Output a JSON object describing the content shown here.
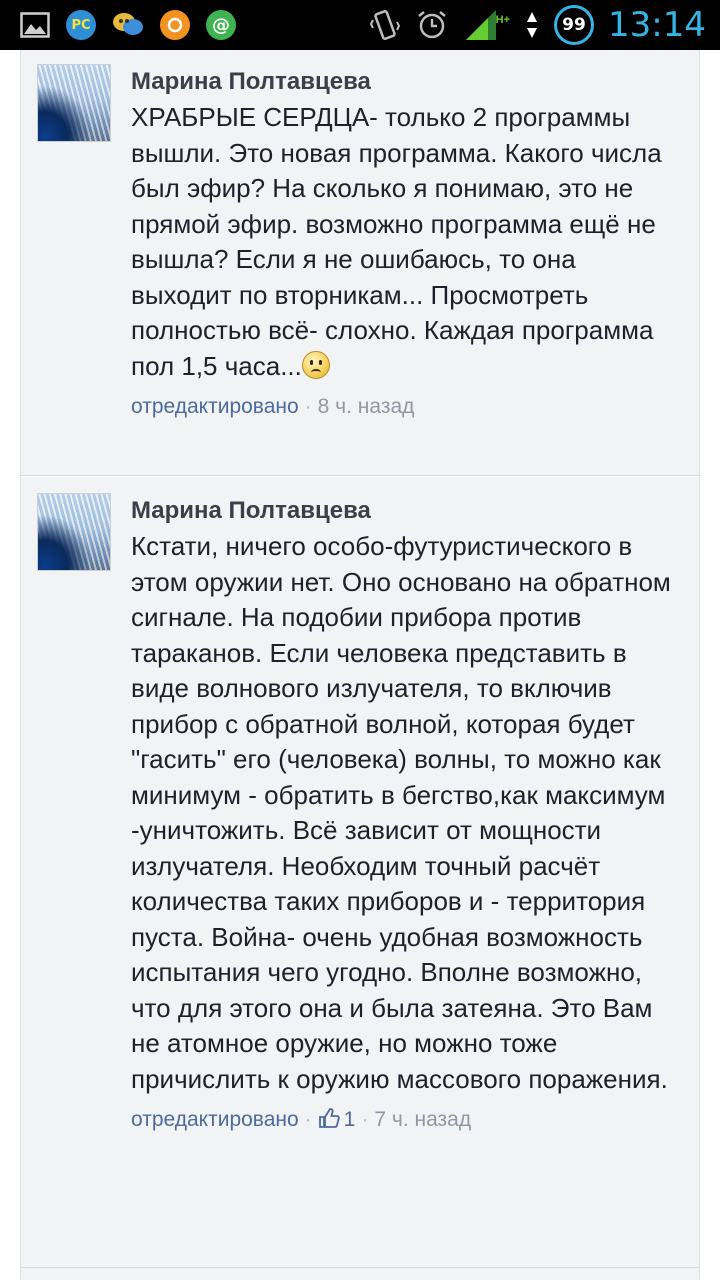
{
  "status_bar": {
    "time": "13:14",
    "battery": "99",
    "network": "H+"
  },
  "colors": {
    "status_accent": "#33b5e5",
    "feed_background": "#f2f3f5",
    "link_blue": "#4b6b9e",
    "meta_gray": "#9197a3"
  },
  "comments": [
    {
      "author": "Марина Полтавцева",
      "text": "ХРАБРЫЕ СЕРДЦА- только 2 программы вышли. Это новая программа. Какого числа был эфир? На сколько я понимаю, это не прямой эфир. возможно программа ещё не вышла? Если я не ошибаюсь, то она выходит по вторникам... Просмотреть полностью всё- слохно. Каждая программа пол 1,5 часа...",
      "emoji": "sad-face-icon",
      "edited": "отредактировано",
      "separator": "·",
      "time": "8 ч. назад"
    },
    {
      "author": "Марина Полтавцева",
      "text": "Кстати, ничего особо-футуристического в этом оружии нет. Оно основано на обратном сигнале. На подобии прибора против тараканов. Если человека представить в виде волнового излучателя, то включив прибор с обратной волной, которая будет \"гасить\" его (человека) волны, то можно как минимум - обратить в бегство,как максимум -уничтожить. Всё зависит от мощности излучателя. Необходим точный расчёт количества таких приборов и - территория пуста. Война- очень удобная возможность испытания чего угодно. Вполне возможно, что для этого она и была затеяна. Это Вам не атомное оружие, но можно тоже причислить к оружию массового поражения.",
      "edited": "отредактировано",
      "separator": "·",
      "likes": "1",
      "time": "7 ч. назад"
    }
  ]
}
